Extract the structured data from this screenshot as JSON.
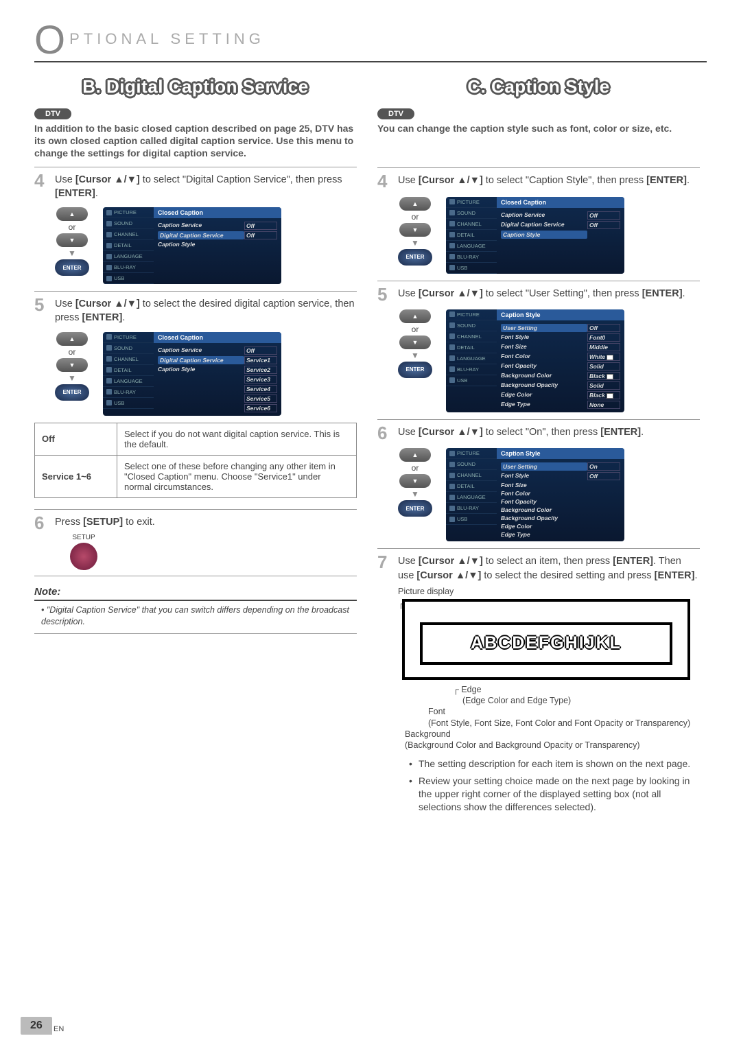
{
  "header": {
    "bigO": "O",
    "rest": "PTIONAL  SETTING"
  },
  "sectionB": {
    "title": "B.  Digital Caption Service",
    "dtv": "DTV",
    "intro": "In addition to the basic closed caption described on page 25, DTV has its own closed caption called digital caption service. Use this menu to change the settings for digital caption service.",
    "step4": "Use [Cursor ▲/▼] to select \"Digital Caption Service\", then press [ENTER].",
    "or": "or",
    "enter": "ENTER",
    "osd4": {
      "title": "Closed Caption",
      "tabs": [
        "PICTURE",
        "SOUND",
        "CHANNEL",
        "DETAIL",
        "LANGUAGE",
        "BLU-RAY",
        "USB"
      ],
      "rows": [
        {
          "k": "Caption Service",
          "v": "Off"
        },
        {
          "k": "Digital Caption Service",
          "v": "Off",
          "sel": true
        },
        {
          "k": "Caption Style",
          "v": ""
        }
      ]
    },
    "step5": "Use [Cursor ▲/▼] to select the desired digital caption service, then press [ENTER].",
    "osd5": {
      "title": "Closed Caption",
      "tabs": [
        "PICTURE",
        "SOUND",
        "CHANNEL",
        "DETAIL",
        "LANGUAGE",
        "BLU-RAY",
        "USB"
      ],
      "rows": [
        {
          "k": "Caption Service",
          "v": "Off"
        },
        {
          "k": "Digital Caption Service",
          "v": "Service1",
          "sel": true
        },
        {
          "k": "Caption Style",
          "v": "Service2"
        },
        {
          "k": "",
          "v": "Service3"
        },
        {
          "k": "",
          "v": "Service4"
        },
        {
          "k": "",
          "v": "Service5"
        },
        {
          "k": "",
          "v": "Service6"
        }
      ]
    },
    "table": [
      {
        "k": "Off",
        "v": "Select if you do not want digital caption service. This is the default."
      },
      {
        "k": "Service 1~6",
        "v": "Select one of these before changing any other item in \"Closed Caption\" menu. Choose \"Service1\" under normal circumstances."
      }
    ],
    "step6": "Press [SETUP] to exit.",
    "setup": "SETUP",
    "noteTitle": "Note:",
    "note": "\"Digital Caption Service\" that you can switch differs depending on the broadcast description."
  },
  "sectionC": {
    "title": "C.  Caption Style",
    "dtv": "DTV",
    "intro": "You can change the caption style such as font, color or size, etc.",
    "step4": "Use [Cursor ▲/▼] to select \"Caption Style\", then press [ENTER].",
    "or": "or",
    "enter": "ENTER",
    "osd4": {
      "title": "Closed Caption",
      "tabs": [
        "PICTURE",
        "SOUND",
        "CHANNEL",
        "DETAIL",
        "LANGUAGE",
        "BLU-RAY",
        "USB"
      ],
      "rows": [
        {
          "k": "Caption Service",
          "v": "Off"
        },
        {
          "k": "Digital Caption Service",
          "v": "Off"
        },
        {
          "k": "Caption Style",
          "v": "",
          "sel": true
        }
      ]
    },
    "step5": "Use [Cursor ▲/▼] to select \"User Setting\", then press [ENTER].",
    "osd5": {
      "title": "Caption Style",
      "tabs": [
        "PICTURE",
        "SOUND",
        "CHANNEL",
        "DETAIL",
        "LANGUAGE",
        "BLU-RAY",
        "USB"
      ],
      "rows": [
        {
          "k": "User Setting",
          "v": "Off",
          "sel": true
        },
        {
          "k": "Font Style",
          "v": "Font0"
        },
        {
          "k": "Font Size",
          "v": "Middle"
        },
        {
          "k": "Font Color",
          "v": "White",
          "sw": true
        },
        {
          "k": "Font Opacity",
          "v": "Solid"
        },
        {
          "k": "Background Color",
          "v": "Black",
          "sw": true
        },
        {
          "k": "Background Opacity",
          "v": "Solid"
        },
        {
          "k": "Edge Color",
          "v": "Black",
          "sw": true
        },
        {
          "k": "Edge Type",
          "v": "None"
        }
      ]
    },
    "step6": "Use [Cursor ▲/▼] to select \"On\", then press [ENTER].",
    "osd6": {
      "title": "Caption Style",
      "tabs": [
        "PICTURE",
        "SOUND",
        "CHANNEL",
        "DETAIL",
        "LANGUAGE",
        "BLU-RAY",
        "USB"
      ],
      "rows": [
        {
          "k": "User Setting",
          "v": "On",
          "sel": true
        },
        {
          "k": "Font Style",
          "v": "Off"
        },
        {
          "k": "Font Size",
          "v": ""
        },
        {
          "k": "Font Color",
          "v": ""
        },
        {
          "k": "Font Opacity",
          "v": ""
        },
        {
          "k": "Background Color",
          "v": ""
        },
        {
          "k": "Background Opacity",
          "v": ""
        },
        {
          "k": "Edge Color",
          "v": ""
        },
        {
          "k": "Edge Type",
          "v": ""
        }
      ]
    },
    "step7": "Use [Cursor ▲/▼] to select an item, then press [ENTER]. Then use [Cursor ▲/▼] to select the desired setting and press [ENTER].",
    "picDisplay": "Picture display",
    "ccSample": "ABCDEFGHIJKL",
    "edge": "Edge",
    "edgeDesc": "(Edge Color and Edge Type)",
    "font": "Font",
    "fontDesc": "(Font Style, Font Size, Font Color and Font Opacity or Transparency)",
    "bg": "Background",
    "bgDesc": "(Background Color and Background Opacity or Transparency)",
    "bullets": [
      "The setting description for each item is shown on the next page.",
      "Review your setting choice made on the next page by looking in the upper right corner of the displayed setting box (not all selections show the differences selected)."
    ]
  },
  "page": {
    "num": "26",
    "lang": "EN"
  }
}
